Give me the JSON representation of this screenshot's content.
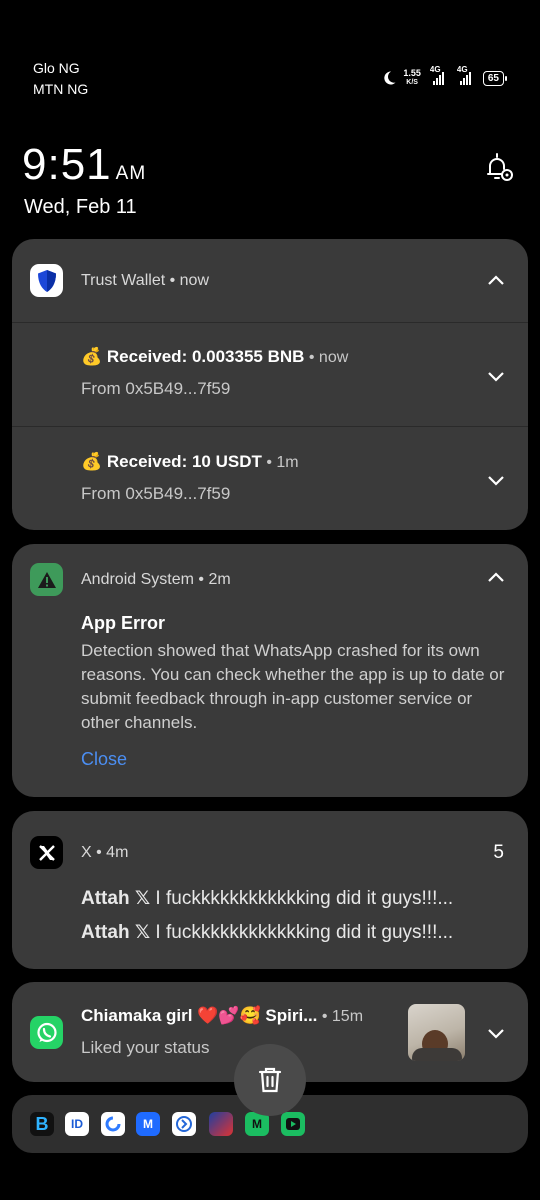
{
  "status_bar": {
    "carrier1": "Glo NG",
    "carrier2": "MTN NG",
    "net_speed_value": "1.55",
    "net_speed_unit": "K/S",
    "net_type1": "4G",
    "net_type2": "4G",
    "battery": "65"
  },
  "clock": {
    "time": "9:51",
    "ampm": "AM",
    "date": "Wed, Feb 11"
  },
  "trust_wallet": {
    "app_name": "Trust Wallet",
    "time": "now",
    "notifications": [
      {
        "emoji": "💰",
        "title": "Received: 0.003355 BNB",
        "time": "now",
        "from": "From 0x5B49...7f59"
      },
      {
        "emoji": "💰",
        "title": "Received: 10 USDT",
        "time": "1m",
        "from": "From 0x5B49...7f59"
      }
    ]
  },
  "android_system": {
    "app_name": "Android System",
    "time": "2m",
    "title": "App Error",
    "body": "Detection showed that WhatsApp crashed for its own reasons. You can check whether the app is up to date or submit feedback through in-app customer service or other channels.",
    "action": "Close"
  },
  "x_app": {
    "app_name": "X",
    "time": "4m",
    "count": "5",
    "messages": [
      {
        "sender": "Attah 𝕏",
        "text": "I fuckkkkkkkkkkkking did it guys!!!..."
      },
      {
        "sender": "Attah 𝕏",
        "text": "I fuckkkkkkkkkkkking did it guys!!!..."
      }
    ]
  },
  "whatsapp": {
    "title": "Chiamaka girl ❤️💕🥰 Spiri...",
    "time": "15m",
    "text": "Liked your status"
  },
  "colors": {
    "card_bg": "#3a3a3a",
    "trust_blue": "#1c47d8",
    "android_green": "#3e9a5a",
    "whatsapp_green": "#25d366",
    "link_blue": "#4b8ef2"
  }
}
